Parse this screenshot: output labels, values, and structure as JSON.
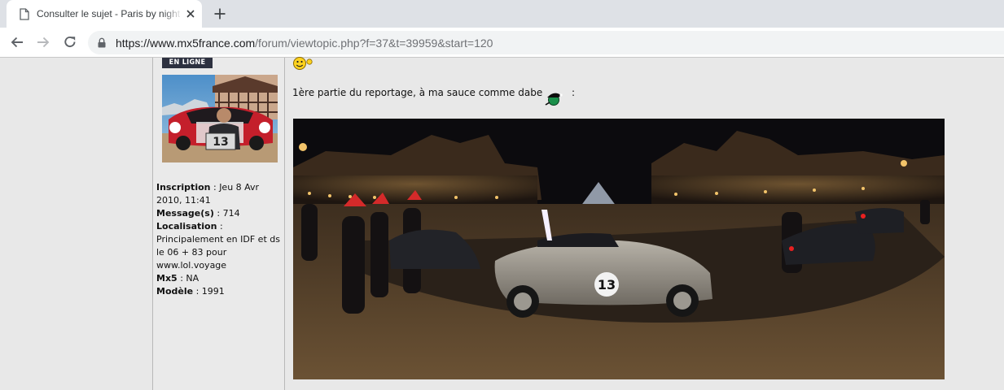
{
  "browser": {
    "tab_title": "Consulter le sujet - Paris by night",
    "url_host": "https://www.mx5france.com",
    "url_path": "/forum/viewtopic.php?f=37&t=39959&start=120"
  },
  "profile": {
    "status_badge": "EN LIGNE",
    "inscription_label": "Inscription",
    "inscription_value": "Jeu 8 Avr 2010, 11:41",
    "messages_label": "Message(s)",
    "messages_value": "714",
    "localisation_label": "Localisation",
    "localisation_value": "Principalement en IDF et ds le 06 + 83 pour www.lol.voyage",
    "mx5_label": "Mx5",
    "mx5_value": "NA",
    "modele_label": "Modèle",
    "modele_value": "1991",
    "avatar_plate": "13"
  },
  "post": {
    "intro_text": "1ère partie du reportage, à ma sauce comme dabe",
    "after_smiley": ":",
    "photo_car_number": "13"
  },
  "colors": {
    "tabstrip": "#dee1e6",
    "badge_bg": "#2d3140",
    "page_bg": "#e8e8e8"
  },
  "icons": [
    "document-icon",
    "close-icon",
    "plus-icon",
    "back-arrow-icon",
    "forward-arrow-icon",
    "reload-icon",
    "lock-icon",
    "smiley-icon",
    "christmas-hat-smiley-icon"
  ]
}
